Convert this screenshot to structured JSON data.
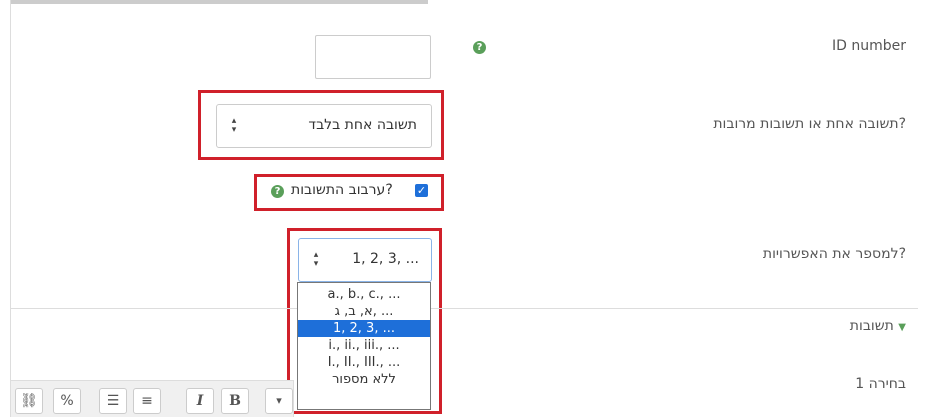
{
  "id_number": {
    "label": "ID number",
    "value": ""
  },
  "single_answer": {
    "label": "תשובה אחת או תשובות מרובות?",
    "selected": "תשובה אחת בלבד"
  },
  "shuffle": {
    "label": "ערבוב התשובות?",
    "checked": true
  },
  "numbering": {
    "label": "למספר את האפשרויות?",
    "selected": "1, 2, 3, ...",
    "options": [
      "a., b., c., ...",
      "א, ב, ג, ...",
      "1, 2, 3, ...",
      "i., ii., iii., ...",
      "I., II., III., ...",
      "ללא מספור"
    ],
    "selected_index": 2
  },
  "answers_section": {
    "label": "תשובות"
  },
  "choice1": {
    "label": "בחירה 1"
  },
  "help_glyph": "?",
  "toolbar": {
    "bold": "B",
    "italic": "I"
  },
  "colors": {
    "accent_red": "#d0202a",
    "help_green": "#5a9f5a",
    "selected_blue": "#1e6fd9"
  }
}
